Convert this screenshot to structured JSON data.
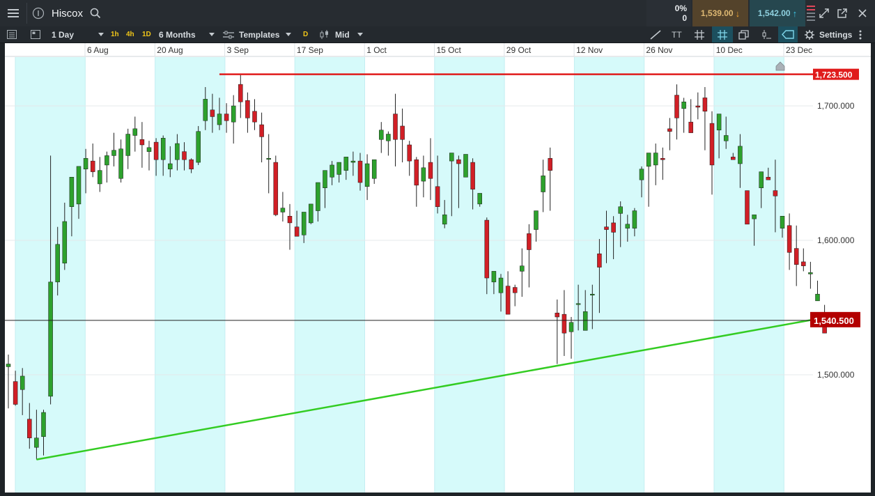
{
  "instrument": {
    "name": "Hiscox"
  },
  "topbar": {
    "change_pct": "0%",
    "change_abs": "0",
    "sell_price": "1,539.00",
    "buy_price": "1,542.00"
  },
  "toolbar": {
    "interval": "1 Day",
    "quick_1h": "1h",
    "quick_4h": "4h",
    "quick_1d": "1D",
    "range": "6 Months",
    "templates": "Templates",
    "d_badge": "D",
    "price_type": "Mid",
    "settings": "Settings",
    "text_tool": "TT"
  },
  "colors": {
    "up": "#2da12d",
    "down": "#d11f26",
    "band": "#d6fafa",
    "resistance": "#e01b1b",
    "support": "#33cc22",
    "price_label_bg": "#b30000"
  },
  "chart_data": {
    "type": "candlestick",
    "xlabels": [
      "6 Aug",
      "20 Aug",
      "3 Sep",
      "17 Sep",
      "1 Oct",
      "15 Oct",
      "29 Oct",
      "12 Nov",
      "26 Nov",
      "10 Dec",
      "23 Dec"
    ],
    "ylabels": [
      "1,700.000",
      "1,600.000",
      "1,500.000"
    ],
    "yticks": [
      1700,
      1600,
      1500
    ],
    "ylim": [
      1421,
      1755
    ],
    "resistance": {
      "value": 1723.5,
      "label": "1,723.500",
      "from_index": 30
    },
    "support": {
      "from_index": 4,
      "from_price": 1437,
      "to_price": 1541
    },
    "last_price": {
      "value": 1540.5,
      "label": "1,540.500"
    },
    "gridlines": true,
    "candles": [
      [
        1506,
        1515,
        1475,
        1508
      ],
      [
        1495,
        1503,
        1477,
        1478
      ],
      [
        1489,
        1505,
        1470,
        1499
      ],
      [
        1467,
        1479,
        1445,
        1453
      ],
      [
        1446,
        1474,
        1437,
        1453
      ],
      [
        1454,
        1474,
        1440,
        1472
      ],
      [
        1484,
        1663,
        1478,
        1569
      ],
      [
        1569,
        1610,
        1559,
        1597
      ],
      [
        1583,
        1628,
        1578,
        1614
      ],
      [
        1625,
        1633,
        1603,
        1647
      ],
      [
        1627,
        1653,
        1616,
        1655
      ],
      [
        1653,
        1668,
        1635,
        1661
      ],
      [
        1659,
        1672,
        1647,
        1651
      ],
      [
        1642,
        1662,
        1636,
        1652
      ],
      [
        1656,
        1666,
        1643,
        1663
      ],
      [
        1663,
        1680,
        1655,
        1667
      ],
      [
        1646,
        1675,
        1643,
        1668
      ],
      [
        1663,
        1683,
        1653,
        1679
      ],
      [
        1678,
        1692,
        1666,
        1683
      ],
      [
        1675,
        1688,
        1654,
        1671
      ],
      [
        1666,
        1674,
        1652,
        1669
      ],
      [
        1673,
        1676,
        1648,
        1660
      ],
      [
        1660,
        1678,
        1648,
        1676
      ],
      [
        1653,
        1670,
        1647,
        1657
      ],
      [
        1660,
        1679,
        1652,
        1672
      ],
      [
        1666,
        1673,
        1652,
        1660
      ],
      [
        1660,
        1661,
        1650,
        1653
      ],
      [
        1658,
        1685,
        1656,
        1681
      ],
      [
        1689,
        1714,
        1682,
        1705
      ],
      [
        1697,
        1709,
        1680,
        1692
      ],
      [
        1686,
        1706,
        1682,
        1694
      ],
      [
        1694,
        1702,
        1680,
        1689
      ],
      [
        1688,
        1708,
        1672,
        1700
      ],
      [
        1716,
        1723,
        1691,
        1703
      ],
      [
        1704,
        1710,
        1680,
        1691
      ],
      [
        1696,
        1705,
        1682,
        1688
      ],
      [
        1686,
        1695,
        1658,
        1677
      ],
      [
        1661,
        1679,
        1635,
        1661
      ],
      [
        1658,
        1663,
        1618,
        1619
      ],
      [
        1621,
        1636,
        1614,
        1624
      ],
      [
        1618,
        1627,
        1593,
        1613
      ],
      [
        1610,
        1622,
        1610,
        1603
      ],
      [
        1604,
        1611,
        1598,
        1621
      ],
      [
        1613,
        1626,
        1612,
        1627
      ],
      [
        1622,
        1636,
        1614,
        1643
      ],
      [
        1639,
        1649,
        1624,
        1652
      ],
      [
        1647,
        1659,
        1641,
        1656
      ],
      [
        1649,
        1658,
        1643,
        1658
      ],
      [
        1652,
        1661,
        1645,
        1662
      ],
      [
        1658,
        1666,
        1648,
        1659
      ],
      [
        1659,
        1665,
        1637,
        1643
      ],
      [
        1640,
        1664,
        1630,
        1657
      ],
      [
        1646,
        1656,
        1642,
        1660
      ],
      [
        1675,
        1688,
        1665,
        1682
      ],
      [
        1674,
        1681,
        1663,
        1679
      ],
      [
        1694,
        1709,
        1655,
        1675
      ],
      [
        1685,
        1698,
        1658,
        1675
      ],
      [
        1671,
        1674,
        1648,
        1659
      ],
      [
        1660,
        1662,
        1625,
        1641
      ],
      [
        1644,
        1663,
        1632,
        1654
      ],
      [
        1658,
        1676,
        1630,
        1646
      ],
      [
        1640,
        1663,
        1620,
        1625
      ],
      [
        1612,
        1630,
        1609,
        1619
      ],
      [
        1659,
        1664,
        1618,
        1665
      ],
      [
        1660,
        1663,
        1624,
        1657
      ],
      [
        1647,
        1661,
        1650,
        1664
      ],
      [
        1658,
        1661,
        1623,
        1638
      ],
      [
        1627,
        1630,
        1625,
        1635
      ],
      [
        1615,
        1617,
        1560,
        1572
      ],
      [
        1569,
        1577,
        1560,
        1577
      ],
      [
        1561,
        1575,
        1547,
        1572
      ],
      [
        1566,
        1577,
        1552,
        1545
      ],
      [
        1565,
        1567,
        1551,
        1561
      ],
      [
        1577,
        1594,
        1558,
        1581
      ],
      [
        1605,
        1612,
        1565,
        1593
      ],
      [
        1608,
        1618,
        1599,
        1622
      ],
      [
        1636,
        1660,
        1621,
        1648
      ],
      [
        1661,
        1669,
        1622,
        1652
      ],
      [
        1546,
        1556,
        1508,
        1543
      ],
      [
        1545,
        1563,
        1514,
        1531
      ],
      [
        1532,
        1543,
        1512,
        1539
      ],
      [
        1553,
        1567,
        1533,
        1553
      ],
      [
        1533,
        1563,
        1536,
        1547
      ],
      [
        1560,
        1567,
        1534,
        1560
      ],
      [
        1590,
        1601,
        1546,
        1580
      ],
      [
        1610,
        1622,
        1583,
        1608
      ],
      [
        1613,
        1618,
        1586,
        1606
      ],
      [
        1620,
        1629,
        1595,
        1625
      ],
      [
        1609,
        1619,
        1599,
        1612
      ],
      [
        1609,
        1624,
        1603,
        1622
      ],
      [
        1645,
        1655,
        1632,
        1653
      ],
      [
        1655,
        1663,
        1625,
        1665
      ],
      [
        1656,
        1672,
        1641,
        1665
      ],
      [
        1661,
        1669,
        1645,
        1660
      ],
      [
        1683,
        1691,
        1667,
        1681
      ],
      [
        1708,
        1716,
        1675,
        1691
      ],
      [
        1698,
        1706,
        1680,
        1703
      ],
      [
        1688,
        1705,
        1680,
        1680
      ],
      [
        1700,
        1710,
        1690,
        1699
      ],
      [
        1706,
        1714,
        1667,
        1696
      ],
      [
        1687,
        1696,
        1634,
        1656
      ],
      [
        1682,
        1691,
        1661,
        1694
      ],
      [
        1674,
        1692,
        1668,
        1678
      ],
      [
        1662,
        1665,
        1664,
        1660
      ],
      [
        1657,
        1679,
        1639,
        1670
      ],
      [
        1637,
        1633,
        1612,
        1612
      ],
      [
        1616,
        1617,
        1596,
        1619
      ],
      [
        1639,
        1649,
        1624,
        1651
      ],
      [
        1647,
        1654,
        1646,
        1645
      ],
      [
        1637,
        1660,
        1606,
        1633
      ],
      [
        1609,
        1618,
        1602,
        1618
      ],
      [
        1611,
        1620,
        1578,
        1591
      ],
      [
        1594,
        1611,
        1566,
        1582
      ],
      [
        1584,
        1594,
        1577,
        1581
      ],
      [
        1575,
        1584,
        1564,
        1576
      ],
      [
        1555,
        1570,
        1555,
        1560
      ],
      [
        1545,
        1552,
        1537,
        1531
      ]
    ]
  }
}
